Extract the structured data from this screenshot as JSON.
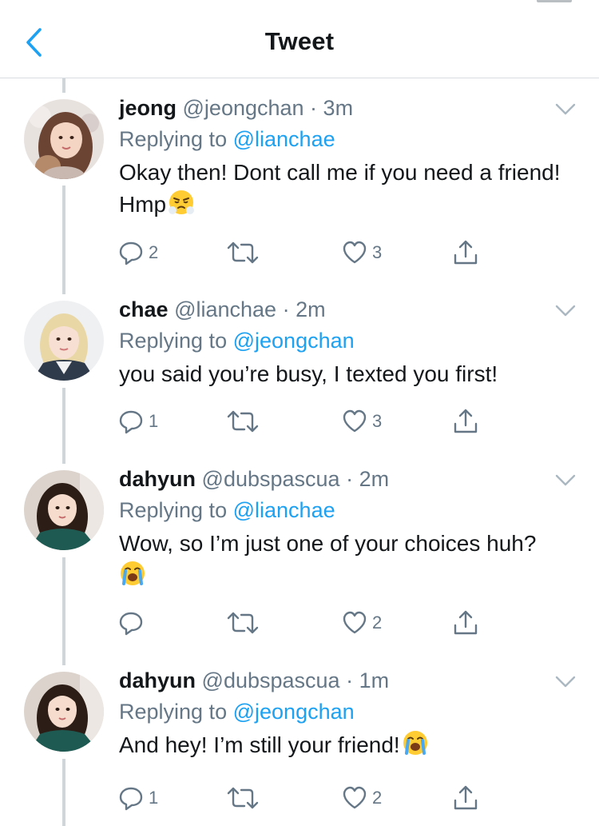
{
  "header": {
    "title": "Tweet"
  },
  "tweets": [
    {
      "name": "jeong",
      "handle": "@jeongchan",
      "time": "3m",
      "replying_prefix": "Replying to",
      "replying_to": "@lianchae",
      "text": "Okay then! Dont call me if you need a friend! Hmp",
      "emoji": "face-with-steam-emoji",
      "replies": "2",
      "retweets": "",
      "likes": "3"
    },
    {
      "name": "chae",
      "handle": "@lianchae",
      "time": "2m",
      "replying_prefix": "Replying to",
      "replying_to": "@jeongchan",
      "text": "you said you’re busy, I texted you first!",
      "emoji": "",
      "replies": "1",
      "retweets": "",
      "likes": "3"
    },
    {
      "name": "dahyun",
      "handle": "@dubspascua",
      "time": "2m",
      "replying_prefix": "Replying to",
      "replying_to": "@lianchae",
      "text": "Wow, so I’m just one of your choices huh?",
      "emoji": "loudly-crying-emoji",
      "replies": "",
      "retweets": "",
      "likes": "2"
    },
    {
      "name": "dahyun",
      "handle": "@dubspascua",
      "time": "1m",
      "replying_prefix": "Replying to",
      "replying_to": "@jeongchan",
      "text": "And hey! I’m still your friend!",
      "emoji": "loudly-crying-emoji",
      "replies": "1",
      "retweets": "",
      "likes": "2"
    }
  ],
  "colors": {
    "accent": "#1da1f2",
    "secondary_text": "#657786",
    "primary_text": "#14171a",
    "thread_line": "#d0d5d9"
  },
  "icons": [
    "back-chevron-icon",
    "reply-icon",
    "retweet-icon",
    "like-icon",
    "share-icon",
    "caret-down-icon"
  ]
}
